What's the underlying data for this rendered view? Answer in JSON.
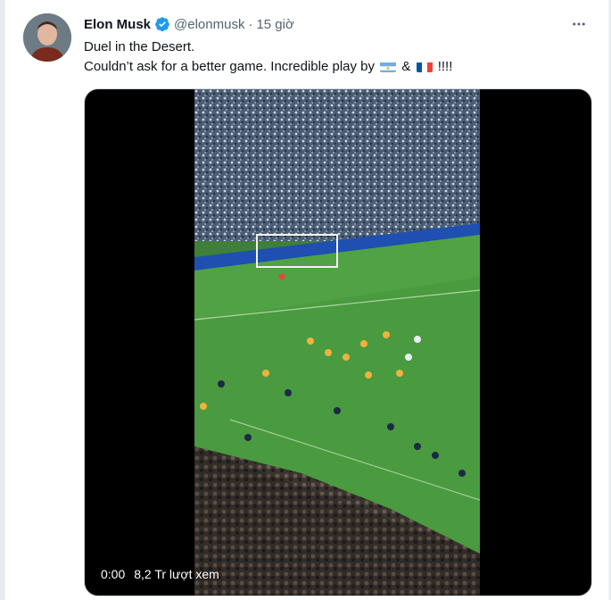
{
  "tweet": {
    "author_name": "Elon Musk",
    "handle": "@elonmusk",
    "separator": "·",
    "time": "15 giờ",
    "line1": "Duel in the Desert.",
    "line2_prefix": "Couldn’t ask for a better game. Incredible play by",
    "line2_amp": "&",
    "line2_suffix": "!!!!"
  },
  "icons": {
    "verified": "verified-badge-icon",
    "more": "more-options-icon",
    "flag_argentina": "argentina-flag-icon",
    "flag_france": "france-flag-icon"
  },
  "video": {
    "time": "0:00",
    "views": "8,2 Tr lượt xem"
  },
  "colors": {
    "verified_blue": "#1d9bf0",
    "text_primary": "#0f1419",
    "text_secondary": "#536471"
  }
}
